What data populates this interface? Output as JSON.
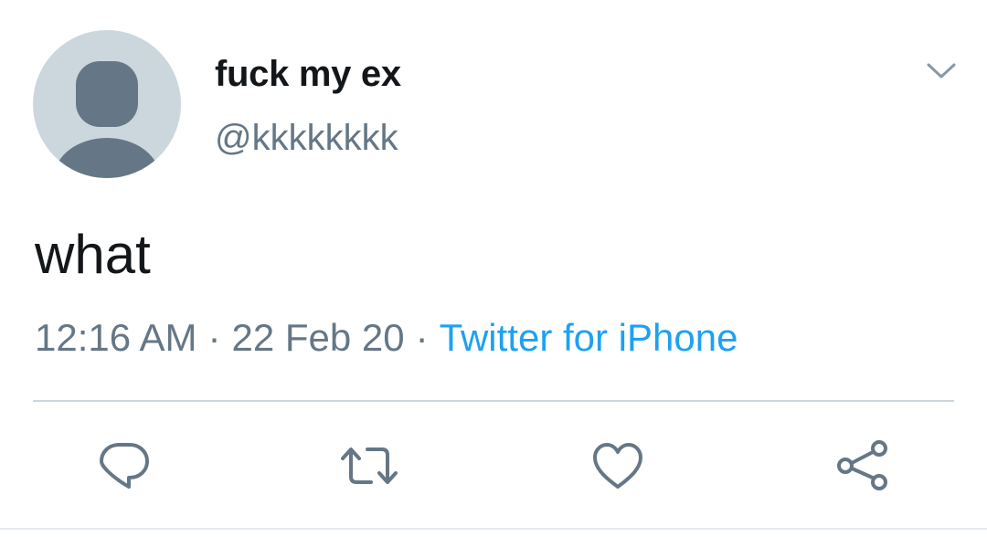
{
  "user": {
    "display_name": "fuck my ex",
    "handle": "@kkkkkkkk"
  },
  "tweet": {
    "text": "what",
    "time": "12:16 AM",
    "date": "22 Feb 20",
    "separator": "·",
    "source": "Twitter for iPhone"
  },
  "actions": {
    "icons": [
      "reply-icon",
      "retweet-icon",
      "like-icon",
      "share-icon"
    ]
  },
  "colors": {
    "text": "#14171a",
    "secondary": "#657786",
    "link": "#1da1f2",
    "avatar_bg": "#ccd6dd",
    "avatar_figure": "#657786",
    "divider": "#ccd6dd"
  }
}
